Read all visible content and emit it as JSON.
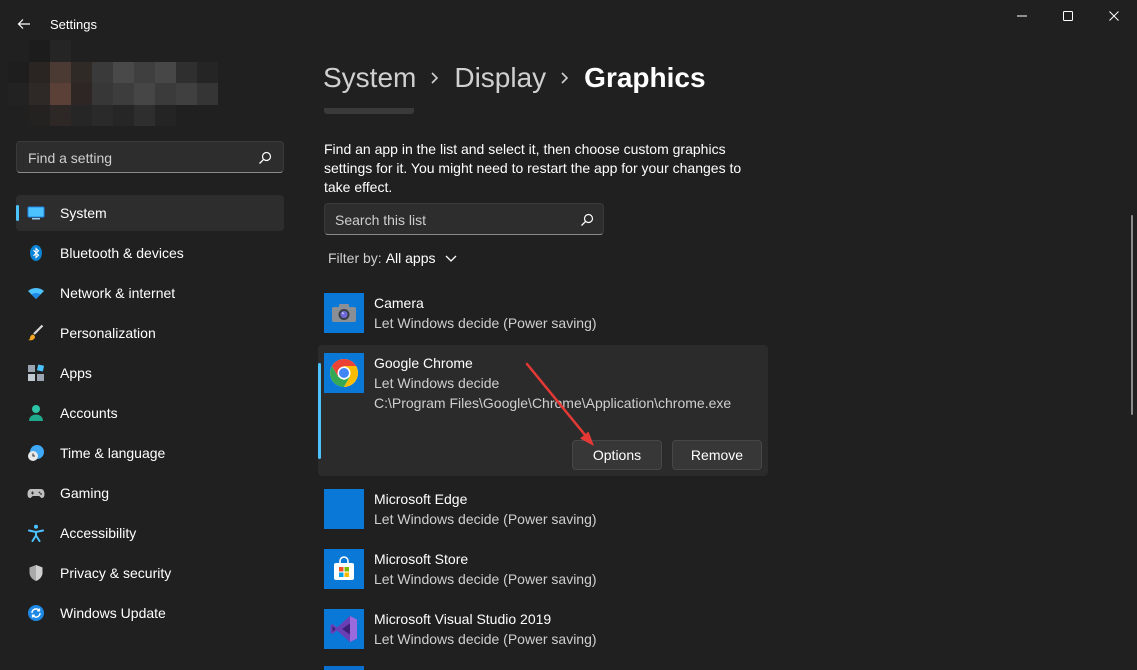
{
  "window": {
    "title": "Settings",
    "controls": [
      "minimize-icon",
      "maximize-icon",
      "close-icon"
    ]
  },
  "search": {
    "placeholder": "Find a setting"
  },
  "sidebar": {
    "items": [
      {
        "label": "System",
        "icon": "system-display-icon",
        "active": true
      },
      {
        "label": "Bluetooth & devices",
        "icon": "bluetooth-icon"
      },
      {
        "label": "Network & internet",
        "icon": "wifi-icon"
      },
      {
        "label": "Personalization",
        "icon": "brush-icon"
      },
      {
        "label": "Apps",
        "icon": "apps-icon"
      },
      {
        "label": "Accounts",
        "icon": "person-icon"
      },
      {
        "label": "Time & language",
        "icon": "globe-clock-icon"
      },
      {
        "label": "Gaming",
        "icon": "gamepad-icon"
      },
      {
        "label": "Accessibility",
        "icon": "accessibility-icon"
      },
      {
        "label": "Privacy & security",
        "icon": "shield-icon"
      },
      {
        "label": "Windows Update",
        "icon": "update-icon"
      }
    ]
  },
  "breadcrumb": {
    "items": [
      "System",
      "Display",
      "Graphics"
    ]
  },
  "main": {
    "description": "Find an app in the list and select it, then choose custom graphics settings for it. You might need to restart the app for your changes to take effect.",
    "list_search_placeholder": "Search this list",
    "filter_label": "Filter by:",
    "filter_value": "All apps",
    "apps": [
      {
        "name": "Camera",
        "status": "Let Windows decide (Power saving)",
        "icon": "camera-icon"
      },
      {
        "name": "Google Chrome",
        "status": "Let Windows decide",
        "path": "C:\\Program Files\\Google\\Chrome\\Application\\chrome.exe",
        "icon": "chrome-icon",
        "expanded": true
      },
      {
        "name": "Microsoft Edge",
        "status": "Let Windows decide (Power saving)",
        "icon": "edge-icon"
      },
      {
        "name": "Microsoft Store",
        "status": "Let Windows decide (Power saving)",
        "icon": "store-icon"
      },
      {
        "name": "Microsoft Visual Studio 2019",
        "status": "Let Windows decide (Power saving)",
        "icon": "visual-studio-icon"
      }
    ],
    "options_label": "Options",
    "remove_label": "Remove"
  },
  "colors": {
    "background": "#202020",
    "accent": "#4cc2ff",
    "annotation_arrow": "#e53935"
  }
}
